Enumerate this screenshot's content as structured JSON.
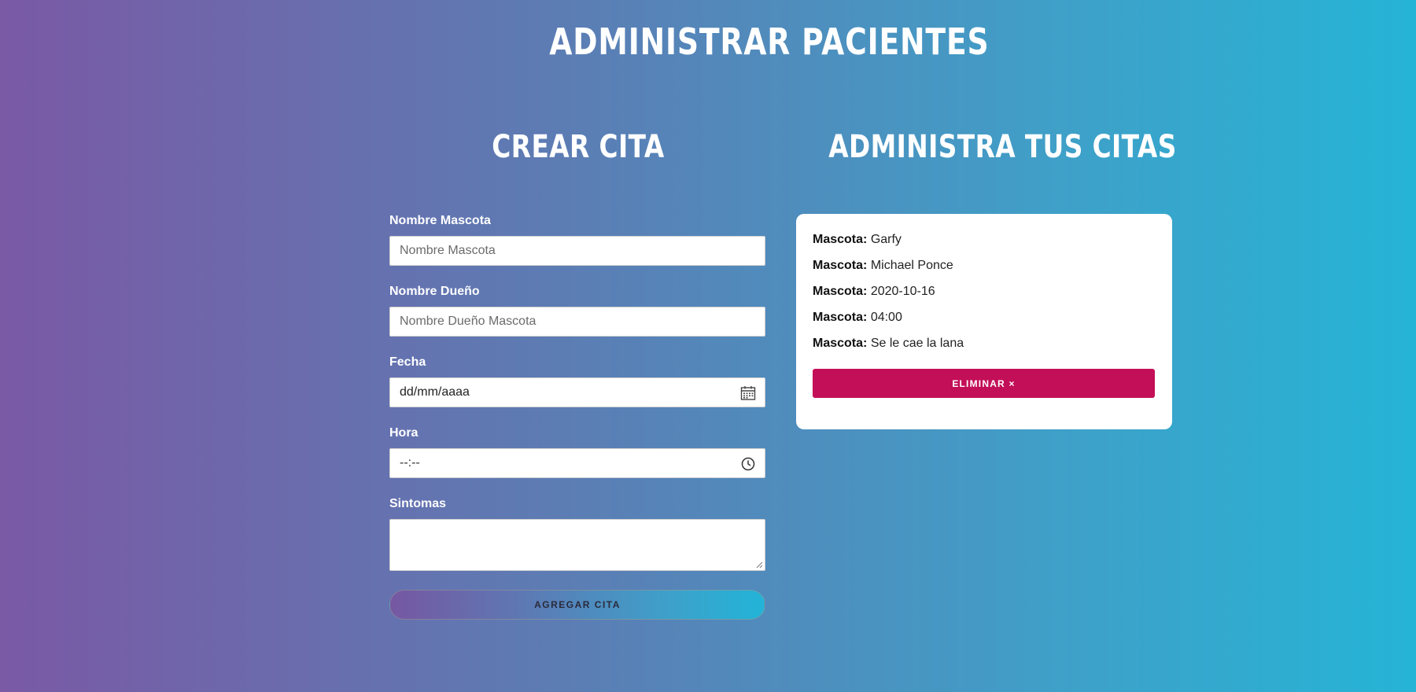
{
  "header": {
    "title": "ADMINISTRAR PACIENTES"
  },
  "form_section": {
    "title": "CREAR CITA",
    "fields": {
      "mascota": {
        "label": "Nombre Mascota",
        "placeholder": "Nombre Mascota",
        "value": ""
      },
      "dueno": {
        "label": "Nombre Dueño",
        "placeholder": "Nombre Dueño Mascota",
        "value": ""
      },
      "fecha": {
        "label": "Fecha",
        "display": "dd/mm/aaaa",
        "icon": "calendar-icon"
      },
      "hora": {
        "label": "Hora",
        "display": "--:--",
        "icon": "clock-icon"
      },
      "sintomas": {
        "label": "Sintomas",
        "value": ""
      }
    },
    "submit_label": "AGREGAR CITA"
  },
  "appointments_section": {
    "title": "ADMINISTRA TUS CITAS",
    "appointments": [
      {
        "rows": [
          {
            "label": "Mascota:",
            "value": "Garfy"
          },
          {
            "label": "Mascota:",
            "value": "Michael Ponce"
          },
          {
            "label": "Mascota:",
            "value": "2020-10-16"
          },
          {
            "label": "Mascota:",
            "value": "04:00"
          },
          {
            "label": "Mascota:",
            "value": "Se le cae la lana"
          }
        ],
        "delete_label": "ELIMINAR ×"
      }
    ]
  },
  "colors": {
    "gradient_start": "#7a59a5",
    "gradient_end": "#25b4d6",
    "delete_button": "#c30f58",
    "card_background": "#ffffff"
  }
}
